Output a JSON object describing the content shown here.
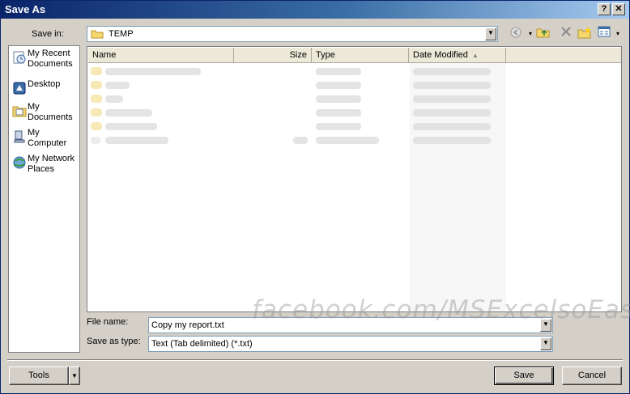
{
  "window": {
    "title": "Save As",
    "help_label": "?",
    "close_label": "✕"
  },
  "save_in": {
    "label": "Save in:",
    "value": "TEMP"
  },
  "toolbar": {
    "icons": [
      "back-icon",
      "up-folder-icon",
      "delete-icon",
      "new-folder-icon",
      "views-menu-icon"
    ]
  },
  "places": [
    {
      "label": "My Recent Documents",
      "icon": "recent-documents-icon"
    },
    {
      "label": "Desktop",
      "icon": "desktop-icon"
    },
    {
      "label": "My Documents",
      "icon": "my-documents-icon"
    },
    {
      "label": "My Computer",
      "icon": "my-computer-icon"
    },
    {
      "label": "My Network Places",
      "icon": "network-places-icon"
    }
  ],
  "file_list": {
    "columns": [
      "Name",
      "Size",
      "Type",
      "Date Modified"
    ],
    "sort_indicator": "▲"
  },
  "file_name": {
    "label": "File name:",
    "value": "Copy my report.txt"
  },
  "save_as_type": {
    "label": "Save as type:",
    "value": "Text (Tab delimited) (*.txt)"
  },
  "watermark": "facebook.com/MSExcelsoEasy",
  "buttons": {
    "tools": "Tools",
    "save": "Save",
    "cancel": "Cancel"
  },
  "colors": {
    "titlebar_start": "#0a246a",
    "titlebar_end": "#a6caf0",
    "dialog_bg": "#d4d0c8"
  }
}
